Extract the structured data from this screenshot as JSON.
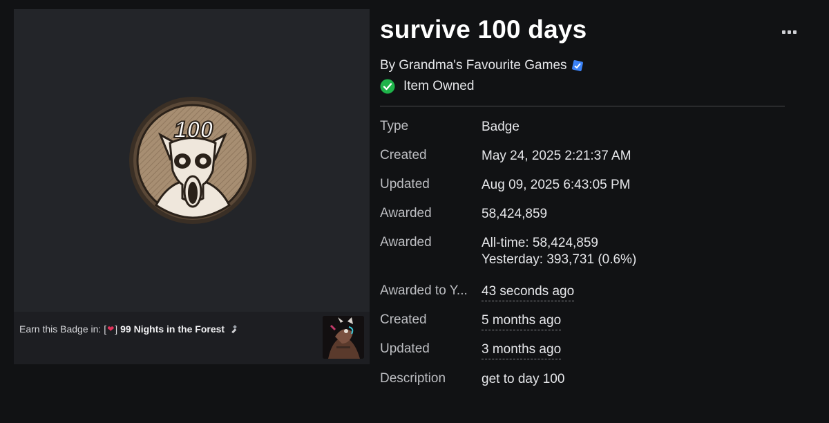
{
  "badge": {
    "title": "survive 100 days",
    "creator_prefix": "By",
    "creator_name": "Grandma's Favourite Games",
    "owned_label": "Item Owned",
    "art_number": "100"
  },
  "earn": {
    "prefix": "Earn this Badge in:",
    "bracket_open": "[",
    "bracket_close": "]",
    "game_name": "99 Nights in the Forest"
  },
  "details": [
    {
      "label": "Type",
      "values": [
        "Badge"
      ]
    },
    {
      "label": "Created",
      "values": [
        "May 24, 2025 2:21:37 AM"
      ]
    },
    {
      "label": "Updated",
      "values": [
        "Aug 09, 2025 6:43:05 PM"
      ]
    },
    {
      "label": "Awarded",
      "values": [
        "58,424,859"
      ]
    },
    {
      "label": "Awarded",
      "values": [
        "All-time: 58,424,859",
        "Yesterday: 393,731 (0.6%)"
      ]
    },
    {
      "label": "Awarded to Y...",
      "values": [
        "43 seconds ago"
      ]
    },
    {
      "label": "Created",
      "values": [
        "5 months ago"
      ]
    },
    {
      "label": "Updated",
      "values": [
        "3 months ago"
      ]
    },
    {
      "label": "Description",
      "values": [
        "get to day 100"
      ]
    }
  ],
  "colors": {
    "background": "#111214",
    "panel": "#232529",
    "verified": "#3b82f6",
    "owned": "#1fb34a"
  },
  "icons": {
    "more": "more-options-icon",
    "verified": "verified-badge-icon",
    "owned": "checkmark-circle-icon",
    "heart": "broken-heart-icon",
    "tool": "flashlight-icon"
  }
}
